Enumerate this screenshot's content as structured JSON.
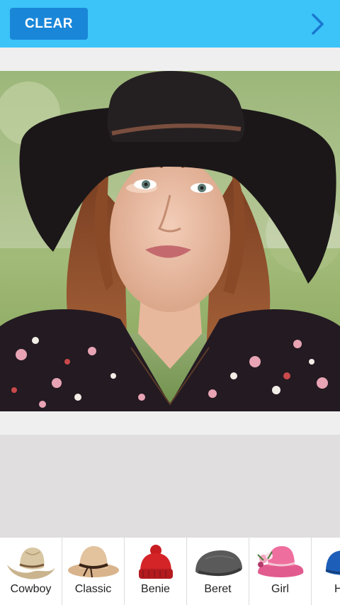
{
  "toolbar": {
    "clear_label": "CLEAR",
    "next_icon": "chevron-right-icon",
    "bar_color": "#3cc3f8",
    "button_color": "#1a86d8"
  },
  "photo": {
    "subject": "woman-wearing-black-wide-brim-hat"
  },
  "hats": [
    {
      "label": "Cowboy",
      "icon": "cowboy-hat-icon"
    },
    {
      "label": "Classic",
      "icon": "classic-hat-icon"
    },
    {
      "label": "Benie",
      "icon": "beanie-icon"
    },
    {
      "label": "Beret",
      "icon": "beret-icon"
    },
    {
      "label": "Girl",
      "icon": "girl-hat-icon"
    },
    {
      "label": "H",
      "icon": "hat-icon"
    }
  ]
}
